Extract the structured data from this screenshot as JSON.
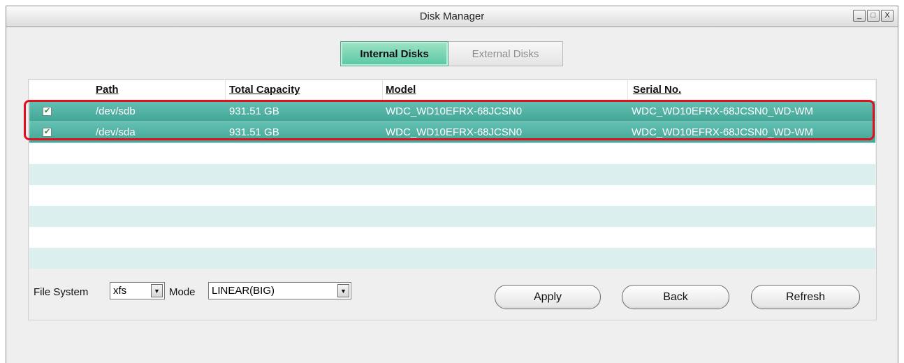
{
  "window": {
    "title": "Disk Manager",
    "minimize_glyph": "_",
    "maximize_glyph": "□",
    "close_glyph": "X"
  },
  "tabs": [
    {
      "label": "Internal Disks",
      "active": true
    },
    {
      "label": "External Disks",
      "active": false
    }
  ],
  "table": {
    "columns": [
      "Path",
      "Total Capacity",
      "Model",
      "Serial No."
    ],
    "rows": [
      {
        "checked": true,
        "path": "/dev/sdb",
        "capacity": "931.51 GB",
        "model": "WDC_WD10EFRX-68JCSN0",
        "serial": "WDC_WD10EFRX-68JCSN0_WD-WM"
      },
      {
        "checked": true,
        "path": "/dev/sda",
        "capacity": "931.51 GB",
        "model": "WDC_WD10EFRX-68JCSN0",
        "serial": "WDC_WD10EFRX-68JCSN0_WD-WM"
      }
    ],
    "check_glyph": "✔"
  },
  "controls": {
    "file_system_label": "File System",
    "file_system_value": "xfs",
    "mode_label": "Mode",
    "mode_value": "LINEAR(BIG)",
    "dropdown_glyph": "▼",
    "apply_label": "Apply",
    "back_label": "Back",
    "refresh_label": "Refresh"
  },
  "colors": {
    "selected_row": "#4fb3a5",
    "stripe_row": "#dbefef",
    "active_tab": "#74d4b2",
    "highlight_outline": "#e0101e"
  }
}
